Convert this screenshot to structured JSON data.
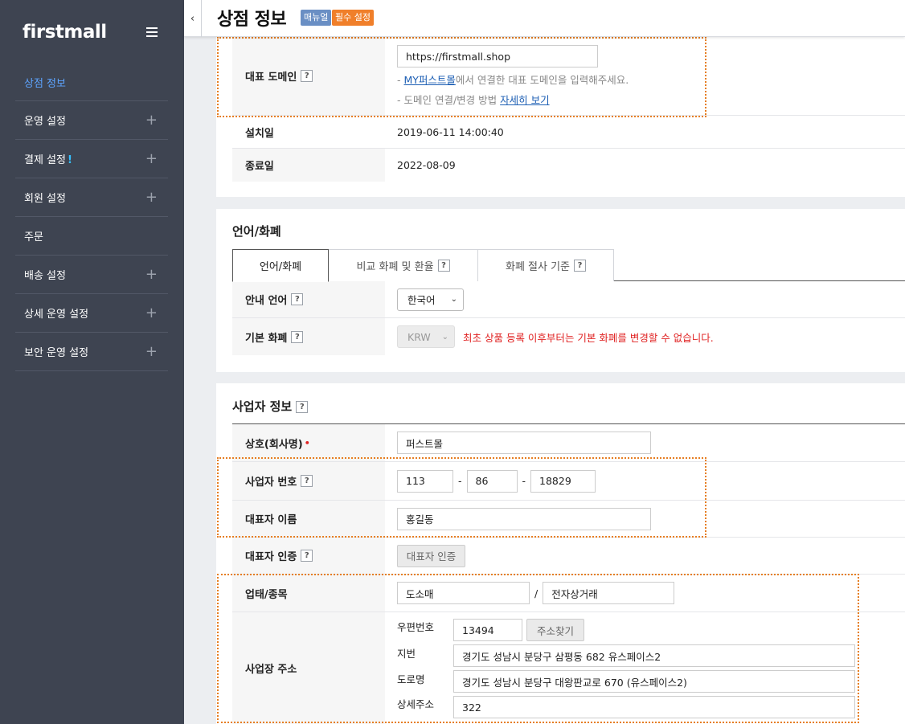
{
  "sidebar": {
    "logo": "firstmall",
    "items": [
      {
        "label": "상점 정보",
        "active": true,
        "expandable": false
      },
      {
        "label": "운영 설정",
        "expandable": true
      },
      {
        "label": "결제 설정",
        "alert": "!",
        "expandable": true
      },
      {
        "label": "회원 설정",
        "expandable": true
      },
      {
        "label": "주문",
        "expandable": false
      },
      {
        "label": "배송 설정",
        "expandable": true
      },
      {
        "label": "상세 운영 설정",
        "expandable": true
      },
      {
        "label": "보안 운영 설정",
        "expandable": true
      }
    ],
    "plus_symbol": "+"
  },
  "header": {
    "collapse_glyph": "‹",
    "title": "상점 정보",
    "badge_manual": "매뉴얼",
    "badge_required": "필수 설정"
  },
  "domain_section": {
    "domain_label": "대표 도메인",
    "domain_value": "https://firstmall.shop",
    "hint1_prefix": "- ",
    "hint1_link": "MY퍼스트몰",
    "hint1_rest": "에서 연결한 대표 도메인을 입력해주세요.",
    "hint2_prefix": "- 도메인 연결/변경 방법 ",
    "hint2_link": "자세히 보기",
    "install_label": "설치일",
    "install_value": "2019-06-11 14:00:40",
    "end_label": "종료일",
    "end_value": "2022-08-09"
  },
  "language_section": {
    "title": "언어/화폐",
    "tabs": [
      {
        "label": "언어/화폐",
        "active": true
      },
      {
        "label": "비교 화폐 및 환율",
        "help": true
      },
      {
        "label": "화폐 절사 기준",
        "help": true
      }
    ],
    "lang_label": "안내 언어",
    "lang_value": "한국어",
    "currency_label": "기본 화폐",
    "currency_value": "KRW",
    "currency_warning": "최초 상품 등록 이후부터는 기본 화폐를 변경할 수 없습니다."
  },
  "business_section": {
    "title": "사업자 정보",
    "company_label": "상호(회사명)",
    "company_required_mark": "•",
    "company_value": "퍼스트몰",
    "bizno_label": "사업자 번호",
    "bizno_1": "113",
    "bizno_2": "86",
    "bizno_3": "18829",
    "bizno_sep": "-",
    "ceo_label": "대표자 이름",
    "ceo_value": "홍길동",
    "ceo_auth_label": "대표자 인증",
    "ceo_auth_button": "대표자 인증",
    "type_label": "업태/종목",
    "type_value": "도소매",
    "type_sep": "/",
    "item_value": "전자상거래",
    "address_label": "사업장 주소",
    "zip_label": "우편번호",
    "zip_value": "13494",
    "zip_button": "주소찾기",
    "jibun_label": "지번",
    "jibun_value": "경기도 성남시 분당구 삼평동 682 유스페이스2",
    "road_label": "도로명",
    "road_value": "경기도 성남시 분당구 대왕판교로 670 (유스페이스2)",
    "detail_label": "상세주소",
    "detail_value": "322"
  },
  "help_glyph": "?",
  "select_chevron": "⌄",
  "colors": {
    "sidebar_bg": "#3e4451",
    "active_nav": "#5da4ff",
    "badge_manual": "#6a8fc4",
    "badge_required": "#f07f2a",
    "highlight_border": "#e67e22",
    "warning": "#e02222"
  }
}
